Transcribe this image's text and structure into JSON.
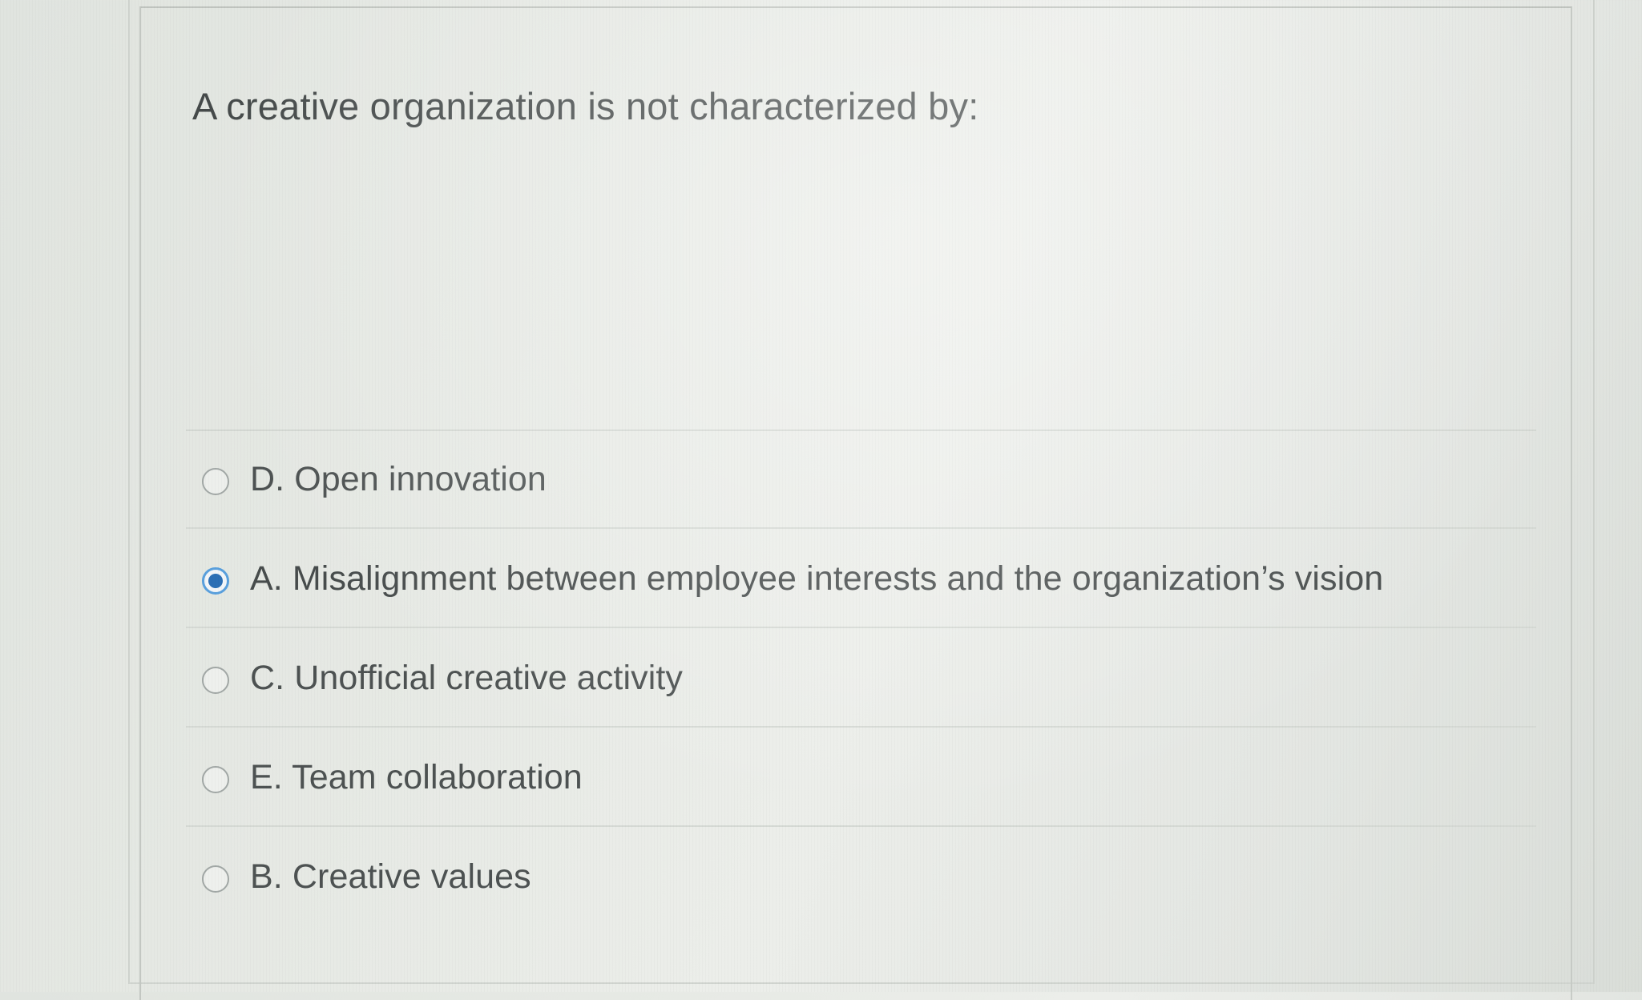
{
  "question": {
    "text": "A creative organization is not characterized by:"
  },
  "options": [
    {
      "label": "D. Open innovation",
      "selected": false
    },
    {
      "label": "A. Misalignment between employee interests and the organization’s vision",
      "selected": true
    },
    {
      "label": "C. Unofficial creative activity",
      "selected": false
    },
    {
      "label": "E. Team collaboration",
      "selected": false
    },
    {
      "label": "B. Creative values",
      "selected": false
    }
  ],
  "colors": {
    "radio_selected_ring": "#5aa0dd",
    "radio_selected_dot": "#2c6fb5",
    "text": "#4d5252"
  }
}
